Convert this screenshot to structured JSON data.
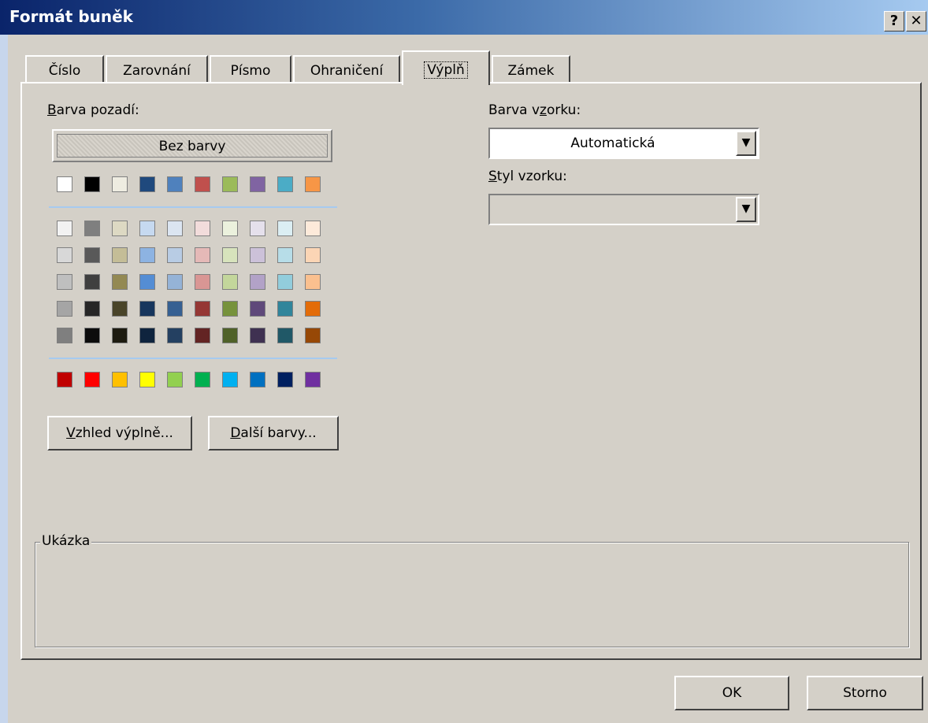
{
  "window": {
    "title": "Formát buněk",
    "help_label": "?",
    "close_label": "✕"
  },
  "tabs": [
    {
      "label": "Číslo"
    },
    {
      "label": "Zarovnání"
    },
    {
      "label": "Písmo"
    },
    {
      "label": "Ohraničení"
    },
    {
      "label": "Výplň"
    },
    {
      "label": "Zámek"
    }
  ],
  "active_tab": "Výplň",
  "fill": {
    "background_label_accel": "B",
    "background_label_rest": "arva pozadí:",
    "no_color_label": "Bez barvy",
    "theme_colors_top": [
      "#ffffff",
      "#000000",
      "#eeece1",
      "#1f497d",
      "#4f81bd",
      "#c0504d",
      "#9bbb59",
      "#8064a2",
      "#4bacc6",
      "#f79646"
    ],
    "theme_tints": [
      [
        "#f2f2f2",
        "#7f7f7f",
        "#ddd9c3",
        "#c6d9f0",
        "#dbe5f1",
        "#f2dcdb",
        "#ebf1dd",
        "#e5e0ec",
        "#dbeef3",
        "#fdeada"
      ],
      [
        "#d8d8d8",
        "#595959",
        "#c4bd97",
        "#8db3e2",
        "#b8cce4",
        "#e5b9b7",
        "#d7e3bc",
        "#ccc1d9",
        "#b7dde8",
        "#fbd5b5"
      ],
      [
        "#bfbfbf",
        "#3f3f3f",
        "#938953",
        "#548dd4",
        "#95b3d7",
        "#d99694",
        "#c3d69b",
        "#b2a2c7",
        "#92cddc",
        "#fac08f"
      ],
      [
        "#a5a5a5",
        "#262626",
        "#494429",
        "#17365d",
        "#366092",
        "#953734",
        "#76923c",
        "#5f497a",
        "#31859b",
        "#e36c09"
      ],
      [
        "#7f7f7f",
        "#0c0c0c",
        "#1d1b10",
        "#0f243e",
        "#244061",
        "#632423",
        "#4f6128",
        "#3f3151",
        "#205867",
        "#974806"
      ]
    ],
    "standard_colors": [
      "#c00000",
      "#ff0000",
      "#ffc000",
      "#ffff00",
      "#92d050",
      "#00b050",
      "#00b0f0",
      "#0070c0",
      "#002060",
      "#7030a0"
    ],
    "fill_effects_accel": "V",
    "fill_effects_rest": "zhled výplně...",
    "more_colors_accel": "D",
    "more_colors_rest": "alší barvy...",
    "pattern_color_label_a": "Barva v",
    "pattern_color_label_accel": "z",
    "pattern_color_label_b": "orku:",
    "pattern_color_value": "Automatická",
    "pattern_style_accel": "S",
    "pattern_style_rest": "tyl vzorku:",
    "pattern_style_value": "",
    "sample_label": "Ukázka"
  },
  "footer": {
    "ok_label": "OK",
    "cancel_label": "Storno"
  }
}
